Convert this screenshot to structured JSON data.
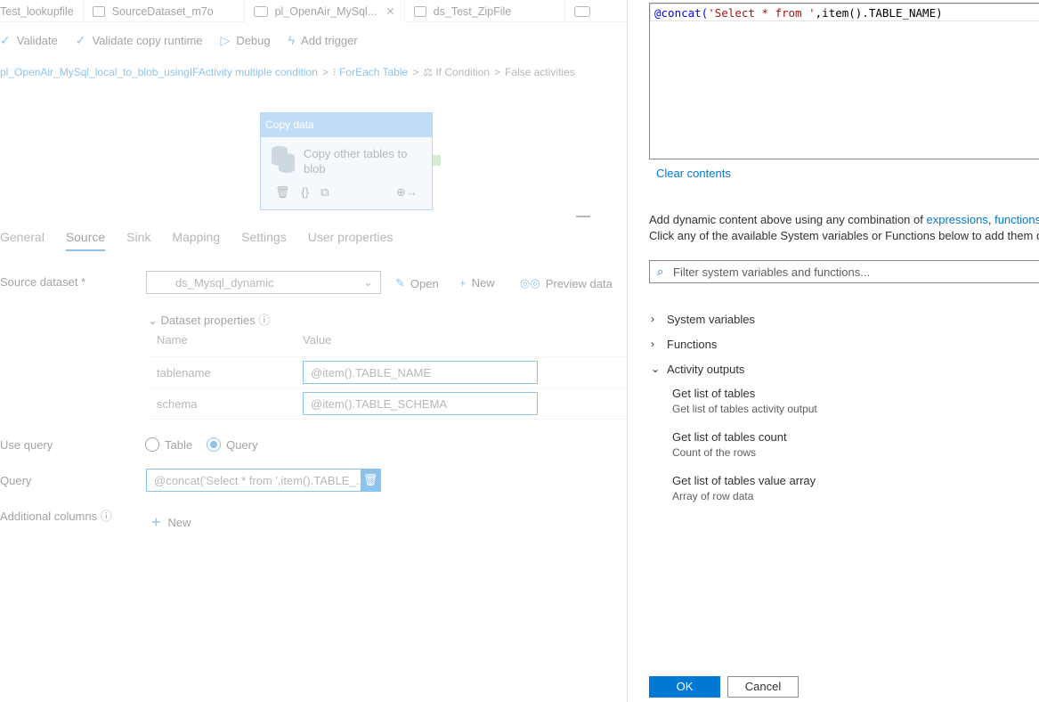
{
  "tabs": [
    {
      "label": "Test_lookupfile"
    },
    {
      "label": "SourceDataset_m7o"
    },
    {
      "label": "pl_OpenAir_MySql...",
      "close": "✕"
    },
    {
      "label": "ds_Test_ZipFile"
    }
  ],
  "toolbar": {
    "validate": "Validate",
    "validate_copy": "Validate copy runtime",
    "debug": "Debug",
    "add_trigger": "Add trigger"
  },
  "breadcrumb": {
    "pipeline": "pl_OpenAir_MySql_local_to_blob_usingIFActivity multiple condition",
    "foreach": "ForEach Table",
    "ifcond": "If Condition",
    "branch": "False activities",
    "sep": ">"
  },
  "activity": {
    "header": "Copy data",
    "title": "Copy other tables to blob",
    "icons": {
      "delete": "🗑",
      "code": "{}",
      "copy": "⧉",
      "arrow": "⊕→"
    }
  },
  "prop_tabs": [
    "General",
    "Source",
    "Sink",
    "Mapping",
    "Settings",
    "User properties"
  ],
  "source": {
    "dataset_label": "Source dataset *",
    "dataset_value": "ds_Mysql_dynamic",
    "open": "Open",
    "new": "New",
    "preview": "Preview data",
    "dataset_props": "Dataset properties",
    "col_name": "Name",
    "col_value": "Value",
    "rows": [
      {
        "name": "tablename",
        "value": "@item().TABLE_NAME"
      },
      {
        "name": "schema",
        "value": "@item().TABLE_SCHEMA"
      }
    ],
    "use_query_label": "Use query",
    "radio_table": "Table",
    "radio_query": "Query",
    "query_label": "Query",
    "query_value": "@concat('Select * from ',item().TABLE_...",
    "additional_label": "Additional columns",
    "add_new": "New"
  },
  "editor": {
    "fn": "@concat(",
    "str": "'Select * from '",
    "rest": ",item().TABLE_NAME)"
  },
  "panel": {
    "clear": "Clear contents",
    "help_line1_pre": "Add dynamic content above using any combination of ",
    "help_link1": "expressions",
    "help_sep": ", ",
    "help_link2": "functions",
    "help_line2": "Click any of the available System variables or Functions below to add them d",
    "filter_placeholder": "Filter system variables and functions...",
    "tree": [
      {
        "label": "System variables",
        "caret": "›"
      },
      {
        "label": "Functions",
        "caret": "›"
      },
      {
        "label": "Activity outputs",
        "caret": "⌄"
      }
    ],
    "outputs": [
      {
        "title": "Get list of tables",
        "desc": "Get list of tables activity output"
      },
      {
        "title": "Get list of tables count",
        "desc": "Count of the rows"
      },
      {
        "title": "Get list of tables value array",
        "desc": "Array of row data"
      }
    ],
    "ok": "OK",
    "cancel": "Cancel"
  }
}
